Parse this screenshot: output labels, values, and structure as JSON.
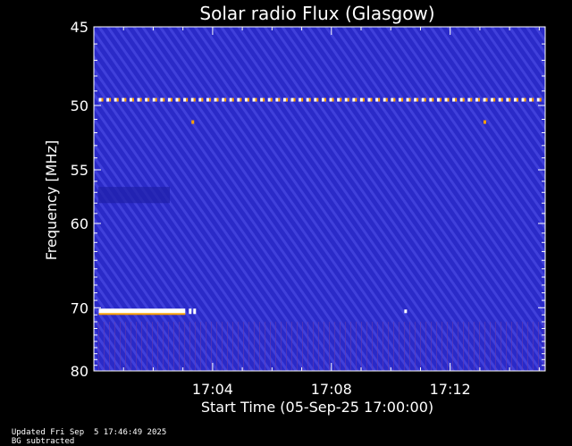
{
  "chart_data": {
    "type": "heatmap",
    "title": "Solar radio Flux (Glasgow)",
    "xlabel": "Start Time (05-Sep-25 17:00:00)",
    "ylabel": "Frequency [MHz]",
    "x_ticks": [
      "17:04",
      "17:08",
      "17:12"
    ],
    "y_ticks": [
      45,
      50,
      55,
      60,
      70,
      80
    ],
    "ylim": [
      45,
      80
    ],
    "y_scale": "reciprocal",
    "colors": {
      "background": "#000000",
      "plot_base": "#2a2ac8",
      "stripe": "#5050e8",
      "hot": "#ffa000",
      "white": "#ffffff",
      "axis": "#ffffff"
    },
    "features": [
      {
        "name": "dotted line",
        "freq_mhz": 49.6,
        "time_start": "17:00:10",
        "time_end": "17:15:00"
      },
      {
        "name": "bright band",
        "freq_mhz": 70.5,
        "time_start": "17:00:10",
        "time_end": "17:03:30"
      },
      {
        "name": "spot",
        "freq_mhz": 51.2,
        "time": "17:03:20"
      },
      {
        "name": "spot",
        "freq_mhz": 51.2,
        "time": "17:13:10"
      },
      {
        "name": "spot",
        "freq_mhz": 70.5,
        "time": "17:10:30"
      }
    ]
  },
  "footer": {
    "updated": "Updated Fri Sep  5 17:46:49 2025",
    "note": "BG subtracted"
  }
}
